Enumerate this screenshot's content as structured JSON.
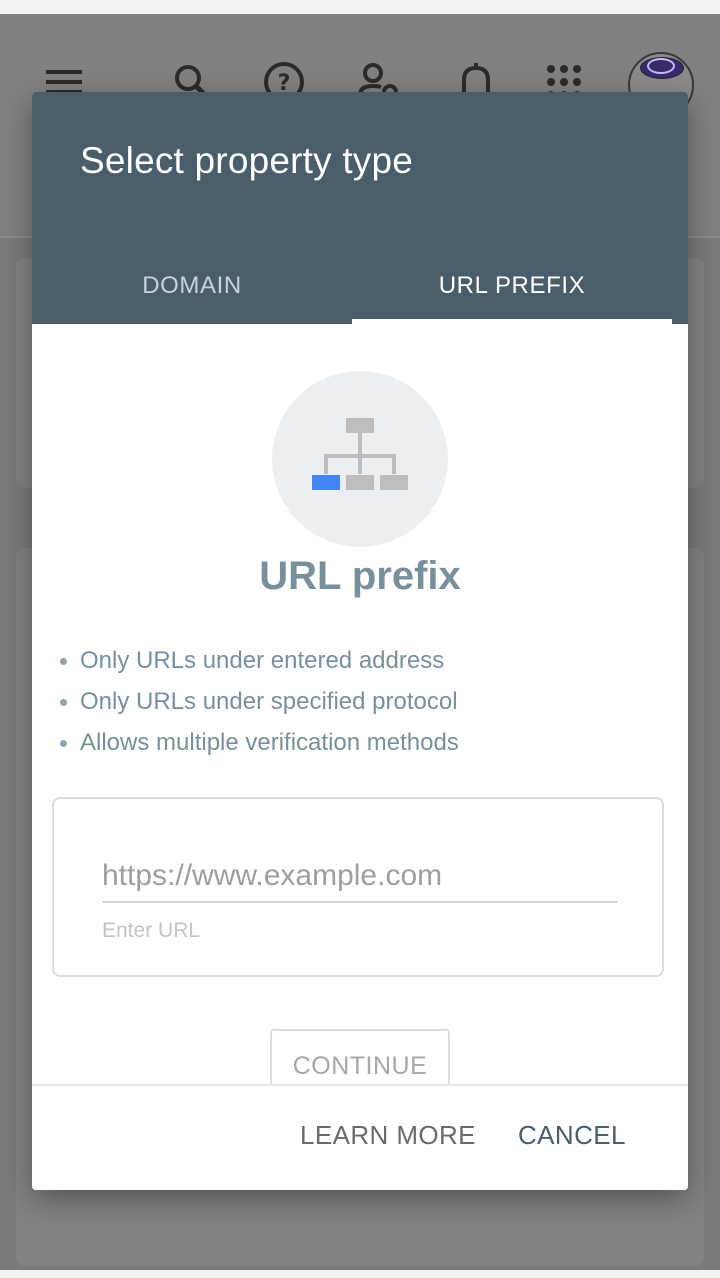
{
  "app_bar": {
    "icons": [
      "menu-icon",
      "search-icon",
      "help-icon",
      "manage-users-icon",
      "notifications-icon",
      "apps-icon",
      "account-avatar"
    ]
  },
  "dialog": {
    "title": "Select property type",
    "tabs": [
      {
        "label": "DOMAIN",
        "selected": false
      },
      {
        "label": "URL PREFIX",
        "selected": true
      }
    ],
    "illustration_icon": "sitemap-icon",
    "option_title": "URL prefix",
    "features": [
      "Only URLs under entered address",
      "Only URLs under specified protocol",
      "Allows multiple verification methods"
    ],
    "url_field": {
      "placeholder": "https://www.example.com",
      "value": "",
      "helper": "Enter URL"
    },
    "continue_label": "CONTINUE",
    "learn_more_label": "LEARN MORE",
    "cancel_label": "CANCEL"
  },
  "colors": {
    "header": "#4a5d6a",
    "accent_blue": "#4285f4",
    "muted_text": "#78909c"
  }
}
